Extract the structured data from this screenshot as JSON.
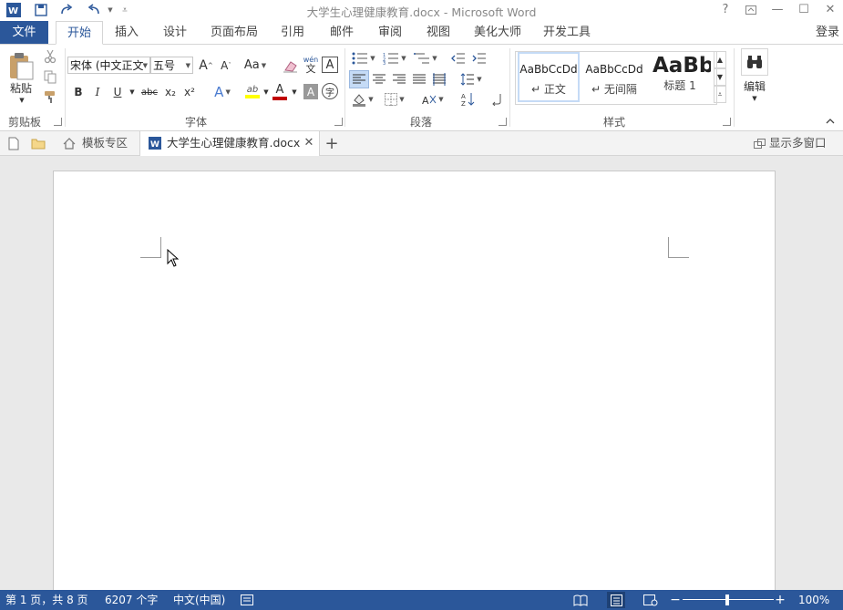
{
  "titlebar": {
    "title": "大学生心理健康教育.docx - Microsoft Word",
    "help": "?",
    "minimize": "—",
    "maximize": "☐",
    "close": "✕"
  },
  "ribbon_tabs": {
    "file": "文件",
    "tabs": [
      "开始",
      "插入",
      "设计",
      "页面布局",
      "引用",
      "邮件",
      "审阅",
      "视图",
      "美化大师",
      "开发工具"
    ],
    "active_index": 0,
    "signin": "登录"
  },
  "clipboard": {
    "paste_label": "粘贴",
    "group_label": "剪贴板"
  },
  "font": {
    "font_name": "宋体 (中文正文",
    "font_size": "五号",
    "group_label": "字体",
    "bold": "B",
    "italic": "I",
    "underline": "U",
    "strike": "abc",
    "subscript": "x₂",
    "superscript": "x²",
    "grow": "A",
    "shrink": "A",
    "case": "Aa",
    "phonetic_top": "wén",
    "phonetic_bottom": "文",
    "border_char": "A",
    "effects": "A",
    "highlight": "ab",
    "font_color": "A",
    "shading_char": "A",
    "enclose": "字"
  },
  "paragraph": {
    "group_label": "段落"
  },
  "styles": {
    "group_label": "样式",
    "items": [
      {
        "sample": "AaBbCcDd",
        "name": "正文"
      },
      {
        "sample": "AaBbCcDd",
        "name": "无间隔"
      },
      {
        "sample": "AaBb",
        "name": "标题 1"
      }
    ]
  },
  "editing": {
    "label": "编辑"
  },
  "doc_tabs": {
    "template_tab": "模板专区",
    "doc_tab": "大学生心理健康教育.docx",
    "show_multi": "显示多窗口"
  },
  "status": {
    "page": "第 1 页，共 8 页",
    "words": "6207 个字",
    "language": "中文(中国)",
    "zoom": "100%"
  },
  "colors": {
    "accent": "#2b579a",
    "font_color_bar": "#c00000",
    "highlight_bar": "#ffff00"
  }
}
